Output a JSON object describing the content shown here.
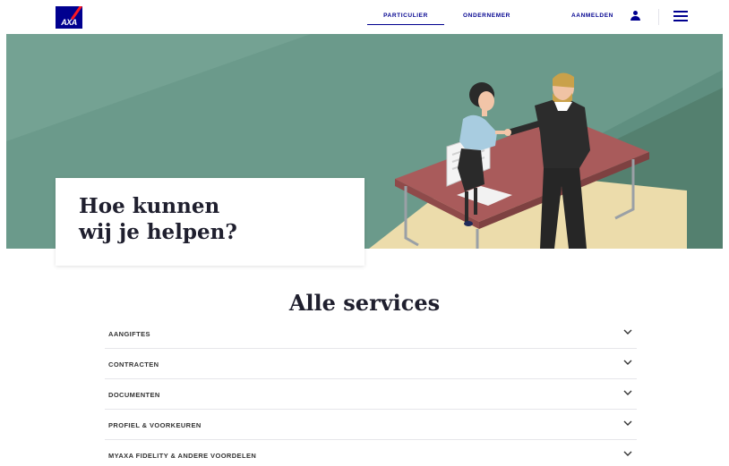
{
  "header": {
    "logo_text": "AXA",
    "nav": {
      "particulier": "PARTICULIER",
      "ondernemer": "ONDERNEMER",
      "aanmelden": "AANMELDEN"
    }
  },
  "hero": {
    "title_line1": "Hoe kunnen",
    "title_line2": "wij je helpen?"
  },
  "services": {
    "title": "Alle services",
    "items": [
      {
        "label": "AANGIFTES"
      },
      {
        "label": "CONTRACTEN"
      },
      {
        "label": "DOCUMENTEN"
      },
      {
        "label": "PROFIEL & VOORKEUREN"
      },
      {
        "label": "MYAXA FIDELITY & ANDERE VOORDELEN"
      }
    ]
  },
  "colors": {
    "brand": "#00008f",
    "accent": "#ff1721",
    "hero_bg": "#5f8f80",
    "desk": "#a85a5a"
  },
  "icons": [
    "axa-logo",
    "user-icon",
    "menu-icon",
    "chevron-down-icon"
  ]
}
